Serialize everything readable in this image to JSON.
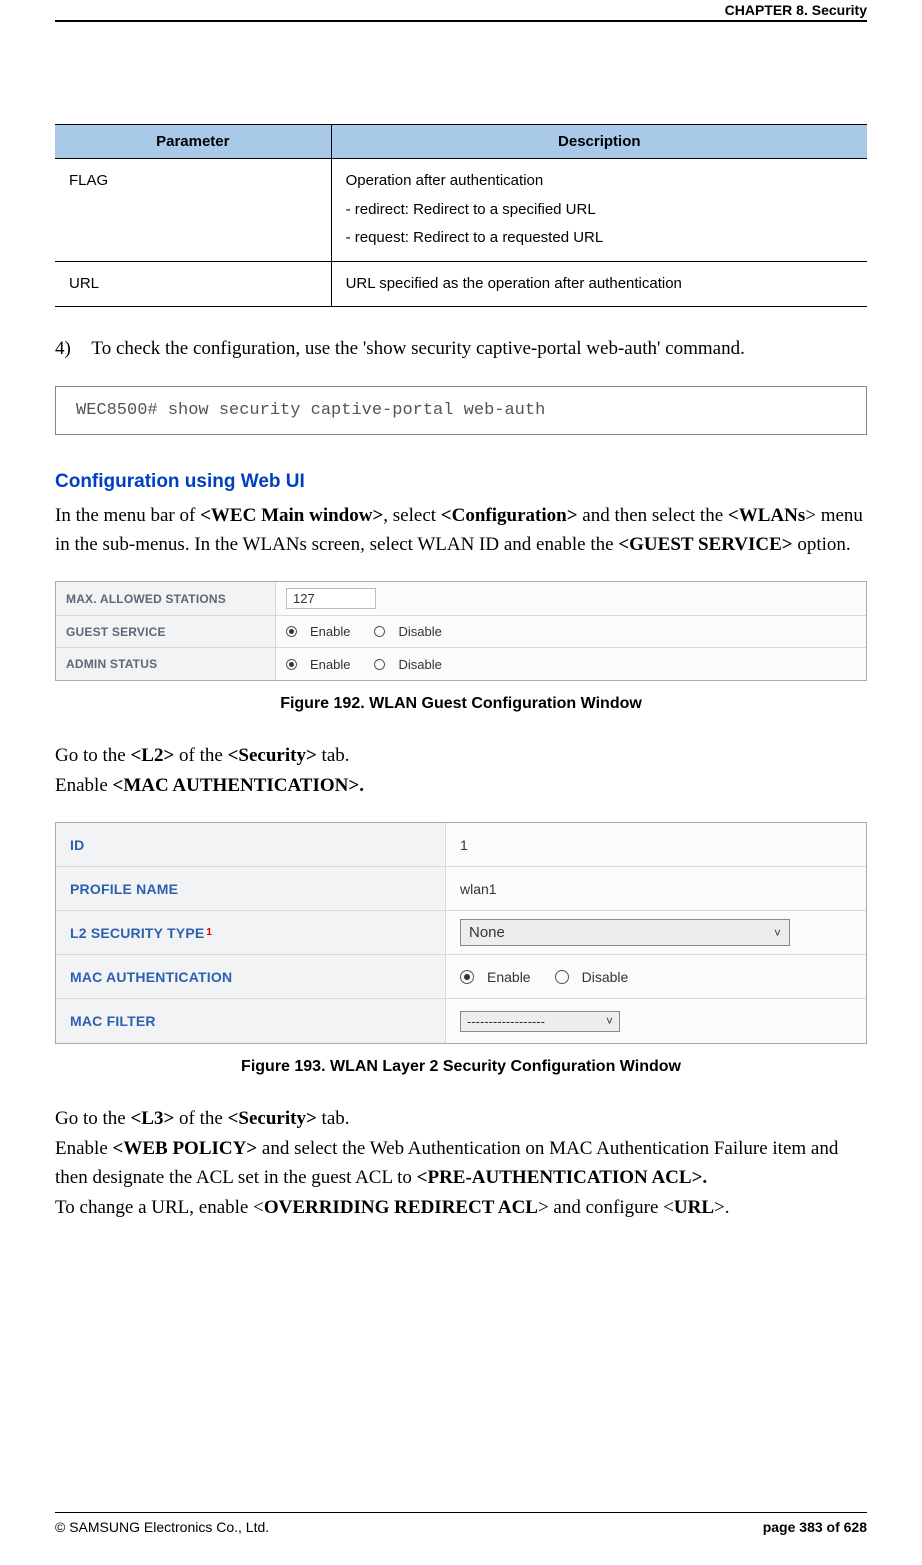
{
  "header": {
    "chapter": "CHAPTER 8. Security"
  },
  "table": {
    "headers": [
      "Parameter",
      "Description"
    ],
    "rows": [
      {
        "param": "FLAG",
        "desc": "Operation after authentication\n- redirect: Redirect to a specified URL\n- request: Redirect to a requested URL"
      },
      {
        "param": "URL",
        "desc": "URL specified as the operation after authentication"
      }
    ]
  },
  "step4": {
    "num": "4)",
    "text": "To check the configuration, use the 'show security captive-portal web-auth' command."
  },
  "code1": "WEC8500# show security captive-portal web-auth",
  "webui_title": "Configuration using Web UI",
  "para1": {
    "p1": "In the menu bar of ",
    "b1": "<WEC Main window>",
    "p2": ", select ",
    "b2": "<Configuration>",
    "p3": " and then select the ",
    "b3": "<WLANs",
    "p4": "> menu in the sub-menus. In the WLANs screen, select WLAN ID and enable the ",
    "b4": "<GUEST SERVICE>",
    "p5": " option."
  },
  "fig192": {
    "rows": {
      "max_label": "MAX. ALLOWED STATIONS",
      "max_value": "127",
      "guest_label": "GUEST SERVICE",
      "admin_label": "ADMIN STATUS",
      "enable": "Enable",
      "disable": "Disable"
    },
    "caption": "Figure 192. WLAN Guest Configuration Window"
  },
  "para2": {
    "p1": "Go to the ",
    "b1": "<L2>",
    "p2": " of the ",
    "b2": "<Security>",
    "p3": " tab.",
    "p4": "Enable ",
    "b3": "<MAC AUTHENTICATION>."
  },
  "fig193": {
    "id_label": "ID",
    "id_value": "1",
    "profile_label": "PROFILE NAME",
    "profile_value": "wlan1",
    "l2type_label": "L2 SECURITY TYPE",
    "l2type_sup": "1",
    "l2type_value": "None",
    "macauth_label": "MAC AUTHENTICATION",
    "enable": "Enable",
    "disable": "Disable",
    "macfilter_label": "MAC FILTER",
    "macfilter_value": "------------------",
    "caption": "Figure 193. WLAN Layer 2 Security Configuration Window"
  },
  "para3": {
    "p1": "Go to the ",
    "b1": "<L3>",
    "p2": " of the ",
    "b2": "<Security>",
    "p3": " tab.",
    "p4": "Enable ",
    "b3": "<WEB POLICY>",
    "p5": " and select the Web Authentication on MAC Authentication Failure item and then designate the ACL set in the guest ACL to ",
    "b4": "<PRE-AUTHENTICATION ACL>.",
    "p6": "To change a URL, enable <",
    "b5": "OVERRIDING REDIRECT ACL",
    "p7": "> and configure <",
    "b6": "URL",
    "p8": ">."
  },
  "footer": {
    "copyright": "© SAMSUNG Electronics Co., Ltd.",
    "page": "page 383 of 628"
  }
}
